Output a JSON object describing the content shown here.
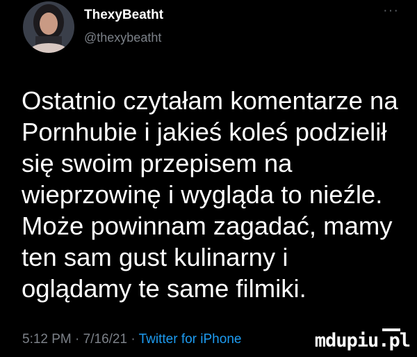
{
  "author": {
    "display_name": "ThexyBeatht",
    "handle": "@thexybeatht"
  },
  "menu_icon": "more-horizontal-icon",
  "tweet": {
    "lines": [
      "Ostatnio czytałam komentarze na",
      "Pornhubie i jakieś koleś podzielił",
      "się swoim przepisem na",
      "wieprzowinę i wygląda to nieźle.",
      "Może powinnam zagadać, mamy",
      "ten sam gust kulinarny i",
      "oglądamy te same filmiki."
    ]
  },
  "meta": {
    "time": "5:12 PM",
    "sep1": " · ",
    "date": "7/16/21",
    "sep2": " · ",
    "source": "Twitter for iPhone"
  },
  "watermark": "mdupiu.pl",
  "colors": {
    "background": "#000000",
    "text": "#ffffff",
    "muted": "#7c8188",
    "link": "#1d9bf0"
  }
}
